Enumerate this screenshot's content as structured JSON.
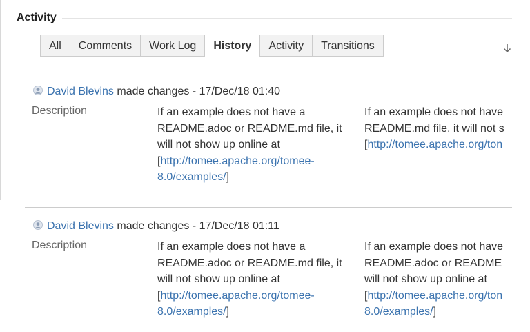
{
  "section": {
    "title": "Activity"
  },
  "tabs": [
    {
      "label": "All"
    },
    {
      "label": "Comments"
    },
    {
      "label": "Work Log"
    },
    {
      "label": "History",
      "active": true
    },
    {
      "label": "Activity"
    },
    {
      "label": "Transitions"
    }
  ],
  "sort_icon": "arrow-down-icon",
  "entries": [
    {
      "author": "David Blevins",
      "action": " made changes - ",
      "timestamp": "17/Dec/18 01:40",
      "field": "Description",
      "old_lines": [
        "If an example does not have a",
        "README.adoc or README.md file, it",
        "will not show up online at"
      ],
      "old_link_open": "[",
      "old_link_lines": [
        "http://tomee.apache.org/tomee-",
        "8.0/examples/"
      ],
      "old_link_close": "]",
      "new_lines": [
        "If an example does not have",
        "README.md file, it will not s"
      ],
      "new_link_open": "[",
      "new_link_lines": [
        "http://tomee.apache.org/ton"
      ]
    },
    {
      "author": "David Blevins",
      "action": " made changes - ",
      "timestamp": "17/Dec/18 01:11",
      "field": "Description",
      "old_lines": [
        "If an example does not have a",
        "README.adoc or README.md file, it",
        "will not show up online at"
      ],
      "old_link_open": "[",
      "old_link_lines": [
        "http://tomee.apache.org/tomee-",
        "8.0/examples/"
      ],
      "old_link_close": "]",
      "new_lines": [
        "If an example does not have",
        "README.adoc or README",
        "will not show up online at"
      ],
      "new_link_open": "[",
      "new_link_lines": [
        "http://tomee.apache.org/ton",
        "8.0/examples/"
      ],
      "new_link_close": "]"
    }
  ],
  "colors": {
    "link": "#3b73af",
    "tab_bg": "#f2f2f2",
    "border": "#cccccc",
    "label": "#666666"
  }
}
